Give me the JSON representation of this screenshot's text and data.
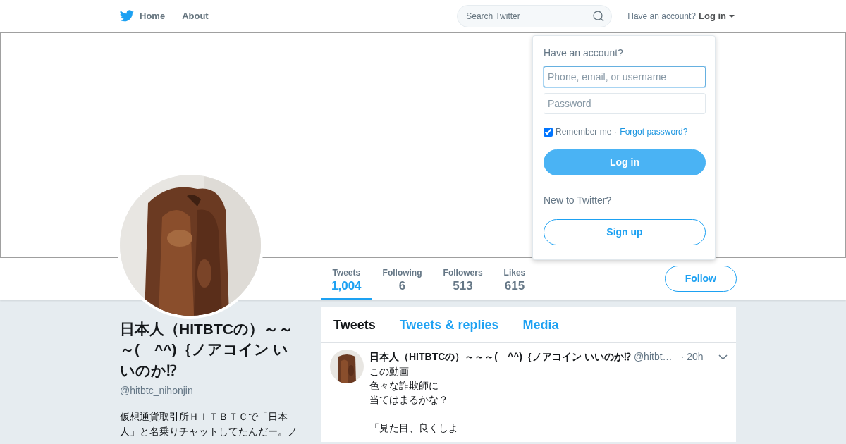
{
  "nav": {
    "home": "Home",
    "about": "About",
    "search_placeholder": "Search Twitter",
    "account_prompt": "Have an account?",
    "login_label": "Log in"
  },
  "login_dropdown": {
    "heading": "Have an account?",
    "username_placeholder": "Phone, email, or username",
    "username_focused": true,
    "password_placeholder": "Password",
    "remember": {
      "label": "Remember me",
      "checked": true
    },
    "separator": "·",
    "forgot": "Forgot password?",
    "login_button": "Log in",
    "new_prompt": "New to Twitter?",
    "signup_button": "Sign up"
  },
  "profile_stats": [
    {
      "label": "Tweets",
      "value": "1,004",
      "selected": true
    },
    {
      "label": "Following",
      "value": "6",
      "selected": false
    },
    {
      "label": "Followers",
      "value": "513",
      "selected": false
    },
    {
      "label": "Likes",
      "value": "615",
      "selected": false
    }
  ],
  "follow_button": "Follow",
  "profile": {
    "name": "日本人（HITBTCの）～～～(　^^)｛ノアコイン いいのか⁉",
    "handle": "@hitbtc_nihonjin",
    "bio": "仮想通貨取引所ＨＩＴＢＴＣで「日本人」と名乗りチャットしてたんだー。ノ"
  },
  "timeline_tabs": [
    {
      "label": "Tweets",
      "selected": true
    },
    {
      "label": "Tweets & replies",
      "selected": false
    },
    {
      "label": "Media",
      "selected": false
    }
  ],
  "tweets": [
    {
      "name": "日本人（HITBTCの）～～～(　^^)｛ノアコイン いいのか⁉",
      "handle": "@hitbt…",
      "time": "· 20h",
      "paragraphs": [
        [
          "この動画",
          "色々な詐欺師に",
          "当てはまるかな？"
        ],
        [
          "「見た目、良くしよ"
        ]
      ]
    }
  ]
}
